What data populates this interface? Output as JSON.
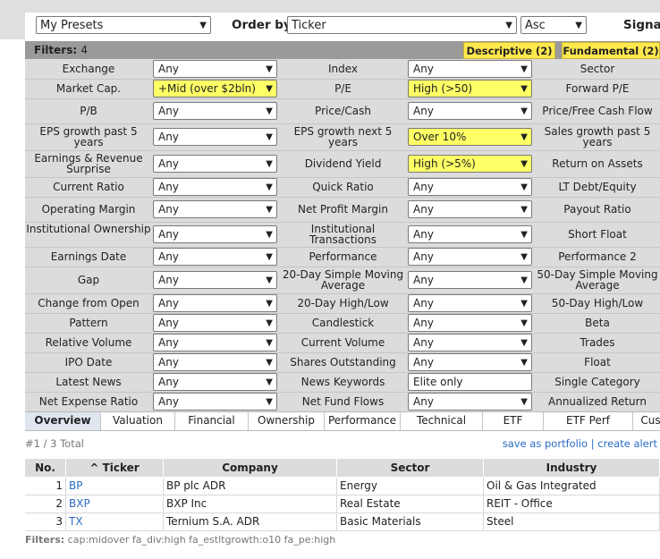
{
  "top": {
    "presets": "My Presets",
    "order_by_label": "Order by",
    "order_by_value": "Ticker",
    "direction": "Asc",
    "signal_label": "Signal"
  },
  "filters_header": {
    "label": "Filters:",
    "count": "4",
    "tabs": [
      "Descriptive (2)",
      "Fundamental (2)"
    ]
  },
  "filter_rows": [
    [
      {
        "label": "Exchange",
        "value": "Any",
        "hl": false
      },
      {
        "label": "Index",
        "value": "Any",
        "hl": false
      },
      {
        "label": "Sector"
      }
    ],
    [
      {
        "label": "Market Cap.",
        "value": "+Mid (over $2bln)",
        "hl": true
      },
      {
        "label": "P/E",
        "value": "High (>50)",
        "hl": true
      },
      {
        "label": "Forward P/E"
      }
    ],
    [
      {
        "label": "P/B",
        "value": "Any",
        "hl": false
      },
      {
        "label": "Price/Cash",
        "value": "Any",
        "hl": false
      },
      {
        "label": "Price/Free Cash Flow"
      }
    ],
    [
      {
        "label": "EPS growth past 5 years",
        "value": "Any",
        "hl": false
      },
      {
        "label": "EPS growth next 5 years",
        "value": "Over 10%",
        "hl": true
      },
      {
        "label": "Sales growth past 5 years"
      }
    ],
    [
      {
        "label": "Earnings & Revenue Surprise",
        "value": "Any",
        "hl": false
      },
      {
        "label": "Dividend Yield",
        "value": "High (>5%)",
        "hl": true
      },
      {
        "label": "Return on Assets"
      }
    ],
    [
      {
        "label": "Current Ratio",
        "value": "Any",
        "hl": false
      },
      {
        "label": "Quick Ratio",
        "value": "Any",
        "hl": false
      },
      {
        "label": "LT Debt/Equity"
      }
    ],
    [
      {
        "label": "Operating Margin",
        "value": "Any",
        "hl": false
      },
      {
        "label": "Net Profit Margin",
        "value": "Any",
        "hl": false
      },
      {
        "label": "Payout Ratio"
      }
    ],
    [
      {
        "label": "Institutional Ownership",
        "value": "Any",
        "hl": false
      },
      {
        "label": "Institutional Transactions",
        "value": "Any",
        "hl": false
      },
      {
        "label": "Short Float"
      }
    ],
    [
      {
        "label": "Earnings Date",
        "value": "Any",
        "hl": false
      },
      {
        "label": "Performance",
        "value": "Any",
        "hl": false
      },
      {
        "label": "Performance 2"
      }
    ],
    [
      {
        "label": "Gap",
        "value": "Any",
        "hl": false
      },
      {
        "label": "20-Day Simple Moving Average",
        "value": "Any",
        "hl": false
      },
      {
        "label": "50-Day Simple Moving Average"
      }
    ],
    [
      {
        "label": "Change from Open",
        "value": "Any",
        "hl": false
      },
      {
        "label": "20-Day High/Low",
        "value": "Any",
        "hl": false
      },
      {
        "label": "50-Day High/Low"
      }
    ],
    [
      {
        "label": "Pattern",
        "value": "Any",
        "hl": false
      },
      {
        "label": "Candlestick",
        "value": "Any",
        "hl": false
      },
      {
        "label": "Beta"
      }
    ],
    [
      {
        "label": "Relative Volume",
        "value": "Any",
        "hl": false
      },
      {
        "label": "Current Volume",
        "value": "Any",
        "hl": false
      },
      {
        "label": "Trades"
      }
    ],
    [
      {
        "label": "IPO Date",
        "value": "Any",
        "hl": false
      },
      {
        "label": "Shares Outstanding",
        "value": "Any",
        "hl": false
      },
      {
        "label": "Float"
      }
    ],
    [
      {
        "label": "Latest News",
        "value": "Any",
        "hl": false
      },
      {
        "label": "News Keywords",
        "value": "Elite only",
        "hl": false,
        "text": true
      },
      {
        "label": "Single Category"
      }
    ],
    [
      {
        "label": "Net Expense Ratio",
        "value": "Any",
        "hl": false
      },
      {
        "label": "Net Fund Flows",
        "value": "Any",
        "hl": false
      },
      {
        "label": "Annualized Return"
      }
    ]
  ],
  "view_tabs": [
    "Overview",
    "Valuation",
    "Financial",
    "Ownership",
    "Performance",
    "Technical",
    "ETF",
    "ETF Perf",
    "Cus"
  ],
  "results": {
    "total": "#1 / 3 Total",
    "save_portfolio": "save as portfolio",
    "separator": "|",
    "create_alert": "create alert",
    "headers": [
      "No.",
      "^ Ticker",
      "Company",
      "Sector",
      "Industry"
    ],
    "rows": [
      [
        "1",
        "BP",
        "BP plc ADR",
        "Energy",
        "Oil & Gas Integrated"
      ],
      [
        "2",
        "BXP",
        "BXP Inc",
        "Real Estate",
        "REIT - Office"
      ],
      [
        "3",
        "TX",
        "Ternium S.A. ADR",
        "Basic Materials",
        "Steel"
      ]
    ]
  },
  "footer": {
    "label": "Filters:",
    "value": "cap:midover fa_div:high fa_estltgrowth:o10 fa_pe:high"
  },
  "colors": {
    "highlight": "#ffff66",
    "link": "#2a6cc4",
    "tab_yellow": "#ffe84d"
  }
}
